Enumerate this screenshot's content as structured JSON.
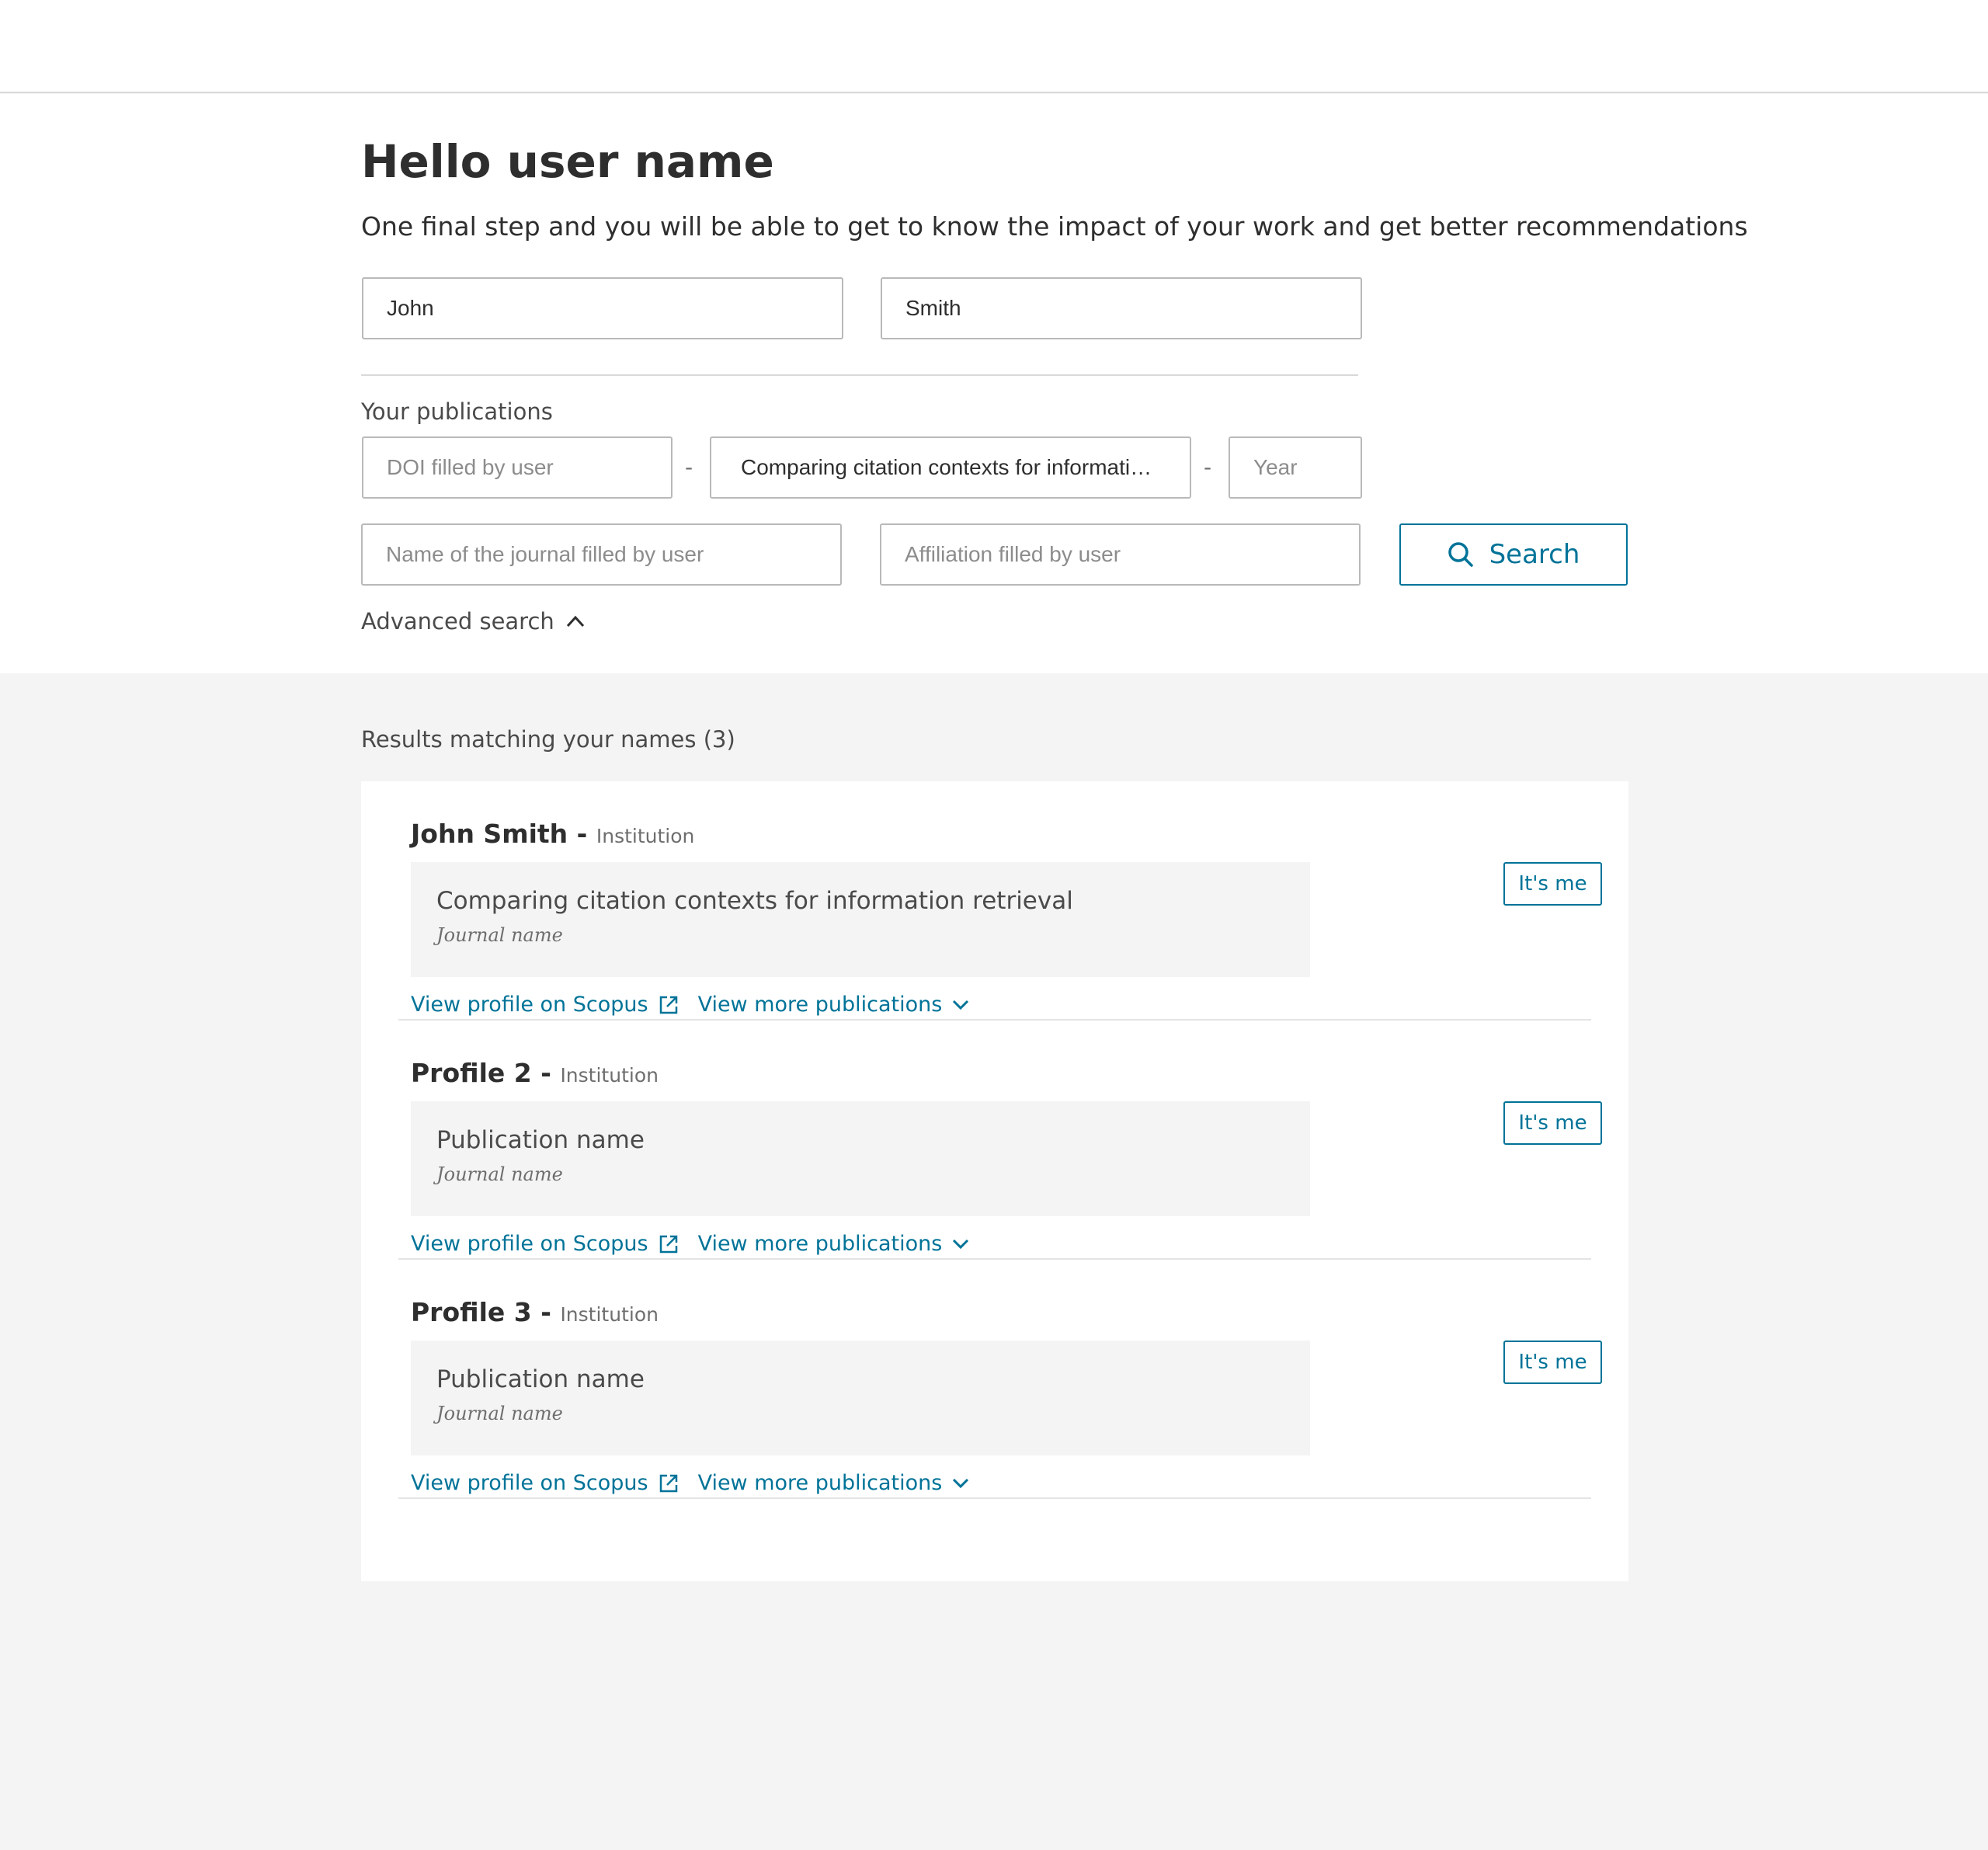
{
  "header": {
    "title": "Hello user name",
    "subtitle": "One final step and you will be able to get to know the impact of your work and get better recommendations"
  },
  "form": {
    "first_name": "John",
    "last_name": "Smith",
    "publications_label": "Your publications",
    "doi_placeholder": "DOI filled by user",
    "title_value": "Comparing citation contexts for informati…",
    "year_placeholder": "Year",
    "journal_placeholder": "Name of the journal filled by user",
    "affiliation_placeholder": "Affiliation filled by user",
    "separator": "-",
    "search_label": "Search",
    "advanced_label": "Advanced search"
  },
  "results": {
    "label": "Results matching your names (3)",
    "profiles": [
      {
        "name": "John Smith",
        "institution": "Institution",
        "publication": "Comparing citation contexts for information retrieval",
        "journal": "Journal name",
        "its_me": "It's me",
        "view_profile": "View profile on Scopus",
        "view_more": "View more publications"
      },
      {
        "name": "Profile 2",
        "institution": "Institution",
        "publication": "Publication name",
        "journal": "Journal name",
        "its_me": "It's me",
        "view_profile": "View profile on Scopus",
        "view_more": "View more publications"
      },
      {
        "name": "Profile 3",
        "institution": "Institution",
        "publication": "Publication name",
        "journal": "Journal name",
        "its_me": "It's me",
        "view_profile": "View profile on Scopus",
        "view_more": "View more publications"
      }
    ],
    "name_separator": " - "
  },
  "colors": {
    "accent": "#007398",
    "text": "#2e2e2e",
    "muted": "#6e6e6e",
    "background": "#f4f4f4"
  },
  "icons": {
    "search": "search-icon",
    "advanced": "chevron-up-icon",
    "external": "external-link-icon",
    "more": "chevron-down-icon"
  }
}
